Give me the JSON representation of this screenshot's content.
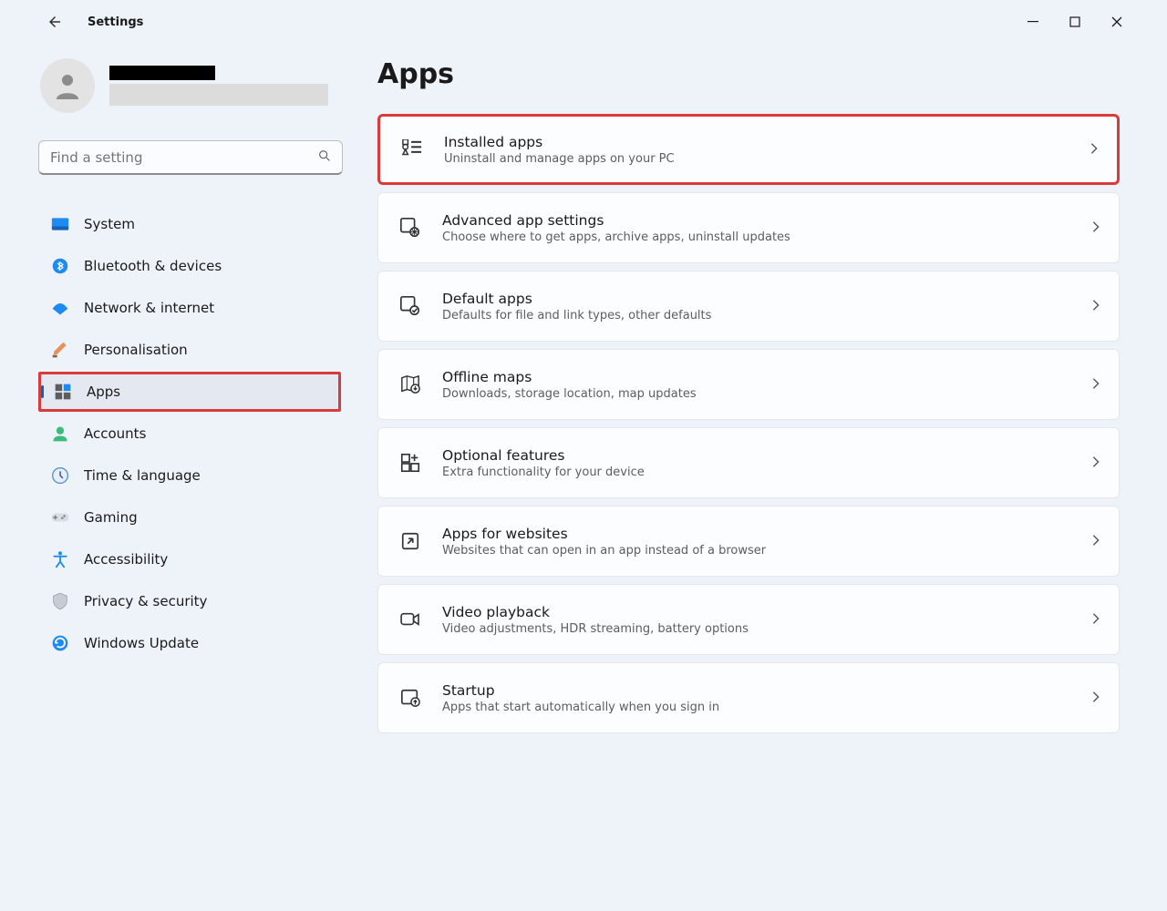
{
  "titlebar": {
    "title": "Settings"
  },
  "user": {
    "name_redacted": true,
    "email_redacted": true
  },
  "search": {
    "placeholder": "Find a setting"
  },
  "sidebar": {
    "items": [
      {
        "label": "System",
        "icon": "system"
      },
      {
        "label": "Bluetooth & devices",
        "icon": "bluetooth"
      },
      {
        "label": "Network & internet",
        "icon": "network"
      },
      {
        "label": "Personalisation",
        "icon": "personalisation"
      },
      {
        "label": "Apps",
        "icon": "apps",
        "selected": true,
        "highlighted": true
      },
      {
        "label": "Accounts",
        "icon": "accounts"
      },
      {
        "label": "Time & language",
        "icon": "time"
      },
      {
        "label": "Gaming",
        "icon": "gaming"
      },
      {
        "label": "Accessibility",
        "icon": "accessibility"
      },
      {
        "label": "Privacy & security",
        "icon": "privacy"
      },
      {
        "label": "Windows Update",
        "icon": "update"
      }
    ]
  },
  "page": {
    "title": "Apps",
    "cards": [
      {
        "title": "Installed apps",
        "desc": "Uninstall and manage apps on your PC",
        "icon": "installed",
        "highlighted": true
      },
      {
        "title": "Advanced app settings",
        "desc": "Choose where to get apps, archive apps, uninstall updates",
        "icon": "advanced"
      },
      {
        "title": "Default apps",
        "desc": "Defaults for file and link types, other defaults",
        "icon": "defaults"
      },
      {
        "title": "Offline maps",
        "desc": "Downloads, storage location, map updates",
        "icon": "maps"
      },
      {
        "title": "Optional features",
        "desc": "Extra functionality for your device",
        "icon": "optional"
      },
      {
        "title": "Apps for websites",
        "desc": "Websites that can open in an app instead of a browser",
        "icon": "websites"
      },
      {
        "title": "Video playback",
        "desc": "Video adjustments, HDR streaming, battery options",
        "icon": "video"
      },
      {
        "title": "Startup",
        "desc": "Apps that start automatically when you sign in",
        "icon": "startup"
      }
    ]
  }
}
